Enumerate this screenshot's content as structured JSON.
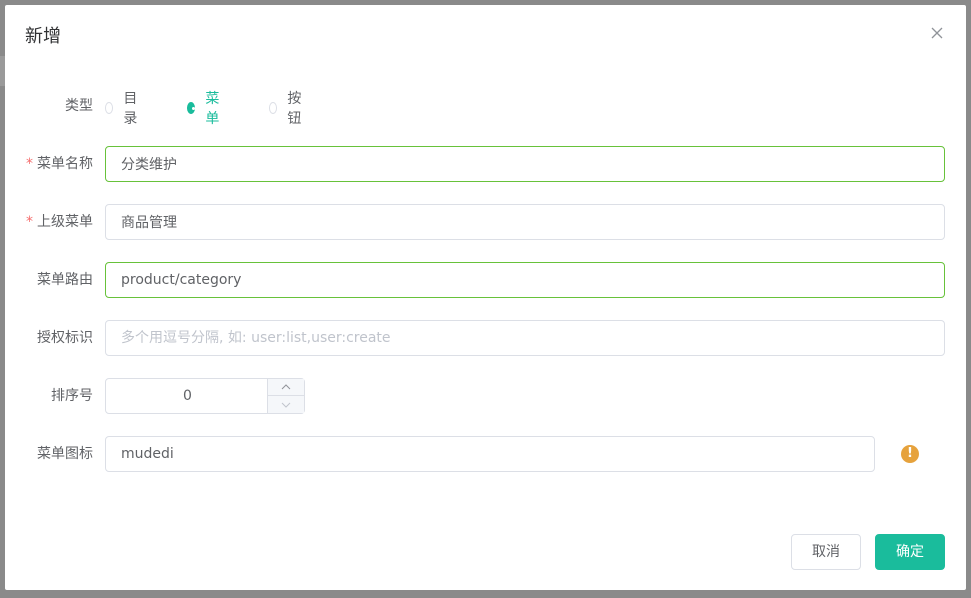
{
  "dialog": {
    "title": "新增"
  },
  "form": {
    "type": {
      "label": "类型",
      "options": [
        "目录",
        "菜单",
        "按钮"
      ],
      "selected": "菜单"
    },
    "menu_name": {
      "required_mark": "*",
      "label": "菜单名称",
      "value": "分类维护"
    },
    "parent_menu": {
      "required_mark": "*",
      "label": "上级菜单",
      "value": "商品管理"
    },
    "menu_route": {
      "label": "菜单路由",
      "value": "product/category"
    },
    "permission": {
      "label": "授权标识",
      "placeholder": "多个用逗号分隔, 如: user:list,user:create",
      "value": ""
    },
    "sort_order": {
      "label": "排序号",
      "value": "0"
    },
    "menu_icon": {
      "label": "菜单图标",
      "value": "mudedi",
      "hint_icon": "!"
    }
  },
  "footer": {
    "cancel_label": "取消",
    "ok_label": "确定"
  },
  "colors": {
    "accent": "#1abc9c",
    "success_border": "#67c23a",
    "warning": "#e6a23c",
    "required": "#f56c6c"
  }
}
